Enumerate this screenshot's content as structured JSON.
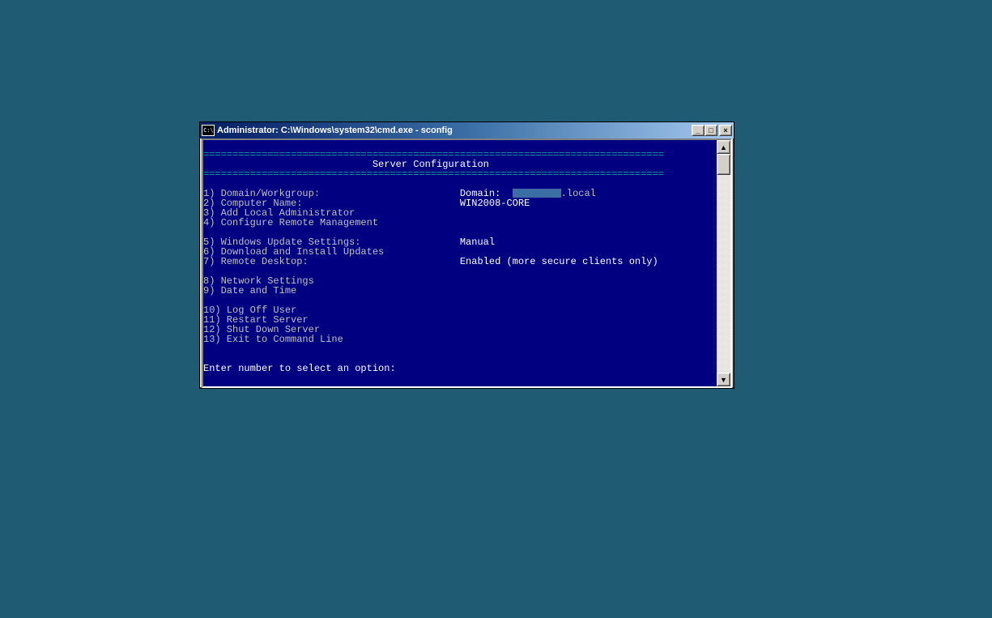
{
  "window": {
    "icon_label": "C:\\",
    "title": "Administrator: C:\\Windows\\system32\\cmd.exe - sconfig",
    "buttons": {
      "minimize": "_",
      "maximize": "□",
      "close": "×"
    }
  },
  "console": {
    "rule": "===============================================================================",
    "header_indent": "                             ",
    "header": "Server Configuration",
    "menu": {
      "group1": [
        {
          "num": "1",
          "label": "Domain/Workgroup:",
          "value_prefix": "Domain:",
          "value_suffix": ".local",
          "redacted": true
        },
        {
          "num": "2",
          "label": "Computer Name:",
          "value": "WIN2008-CORE"
        },
        {
          "num": "3",
          "label": "Add Local Administrator",
          "value": ""
        },
        {
          "num": "4",
          "label": "Configure Remote Management",
          "value": ""
        }
      ],
      "group2": [
        {
          "num": "5",
          "label": "Windows Update Settings:",
          "value": "Manual"
        },
        {
          "num": "6",
          "label": "Download and Install Updates",
          "value": ""
        },
        {
          "num": "7",
          "label": "Remote Desktop:",
          "value": "Enabled (more secure clients only)"
        }
      ],
      "group3": [
        {
          "num": "8",
          "label": "Network Settings",
          "value": ""
        },
        {
          "num": "9",
          "label": "Date and Time",
          "value": ""
        }
      ],
      "group4": [
        {
          "num": "10",
          "label": "Log Off User",
          "value": ""
        },
        {
          "num": "11",
          "label": "Restart Server",
          "value": ""
        },
        {
          "num": "12",
          "label": "Shut Down Server",
          "value": ""
        },
        {
          "num": "13",
          "label": "Exit to Command Line",
          "value": ""
        }
      ]
    },
    "prompt_label": "Enter number to select an option:",
    "prompt_value": ""
  },
  "scrollbar": {
    "up": "▲",
    "down": "▼"
  }
}
